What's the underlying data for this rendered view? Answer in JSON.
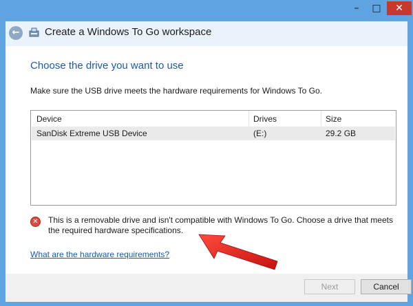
{
  "window": {
    "title": "Create a Windows To Go workspace",
    "minimize_glyph": "–",
    "maximize_glyph": "□",
    "close_glyph": "✕"
  },
  "nav": {
    "back_glyph": "←"
  },
  "page": {
    "heading": "Choose the drive you want to use",
    "instruction": "Make sure the USB drive meets the hardware requirements for Windows To Go."
  },
  "device_list": {
    "columns": [
      "Device",
      "Drives",
      "Size"
    ],
    "rows": [
      {
        "device": "SanDisk Extreme USB Device",
        "drives": "(E:)",
        "size": "29.2 GB"
      }
    ]
  },
  "error": {
    "icon": "error-x-icon",
    "glyph": "✕",
    "message": "This is a removable drive and isn't compatible with Windows To Go. Choose a drive that meets the required hardware specifications."
  },
  "help_link": "What are the hardware requirements?",
  "buttons": {
    "next": "Next",
    "cancel": "Cancel"
  },
  "colors": {
    "window_frame": "#5fa3e0",
    "heading_blue": "#1b5aa6",
    "close_red": "#c7392e",
    "annotation_arrow": "#e0211f"
  }
}
